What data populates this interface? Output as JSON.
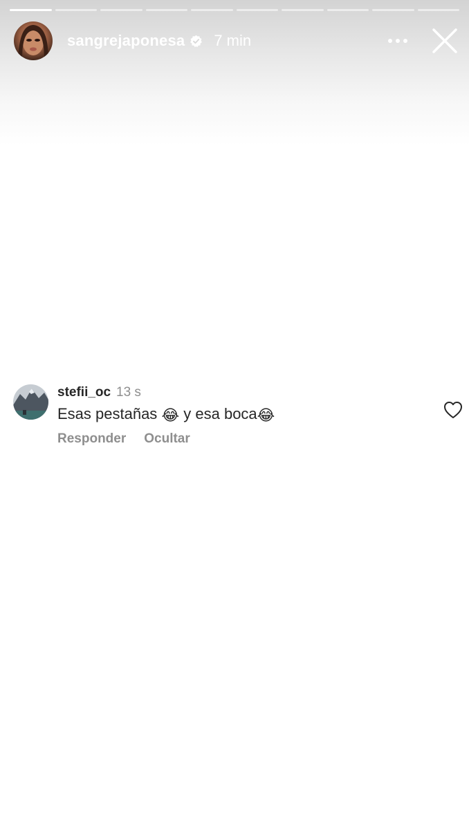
{
  "story": {
    "progress": {
      "segments_total": 10,
      "current_index": 0,
      "current_fraction": 1.0
    },
    "header": {
      "username": "sangrejaponesa",
      "verified": true,
      "time": "7 min",
      "avatar_icon": "profile-photo",
      "more_icon": "more-horizontal-icon",
      "close_icon": "close-icon"
    }
  },
  "comment": {
    "username": "stefii_oc",
    "time": "13 s",
    "text_part1": "Esas pestañas ",
    "emoji1": "😂",
    "text_part2": " y esa boca",
    "emoji2": "😂",
    "reply_label": "Responder",
    "hide_label": "Ocultar",
    "like_icon": "heart-outline-icon"
  },
  "colors": {
    "text_primary": "#262626",
    "text_secondary": "#8e8e8e",
    "header_text": "#ffffff"
  }
}
